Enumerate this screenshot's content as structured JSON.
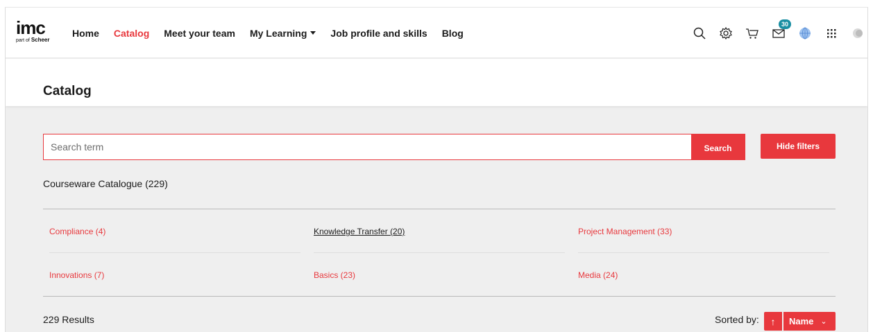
{
  "brand": {
    "logo_text": "imc",
    "logo_sub_small": "part of",
    "logo_sub_bold": "Scheer"
  },
  "nav": {
    "home": "Home",
    "catalog": "Catalog",
    "team": "Meet your team",
    "learning": "My Learning",
    "job": "Job profile and skills",
    "blog": "Blog"
  },
  "header_icons": {
    "search": "search-icon",
    "settings": "gear-icon",
    "cart": "cart-icon",
    "messages": "mail-icon",
    "messages_badge": "30",
    "language": "globe-icon",
    "apps": "apps-grid-icon",
    "profile": "avatar"
  },
  "page": {
    "title": "Catalog"
  },
  "search": {
    "placeholder": "Search term",
    "button_label": "Search",
    "hide_filters_label": "Hide filters"
  },
  "catalogue": {
    "name": "Courseware Catalogue (229)"
  },
  "categories": [
    {
      "label": "Compliance (4)"
    },
    {
      "label": "Knowledge Transfer (20)"
    },
    {
      "label": "Project Management (33)"
    },
    {
      "label": "Innovations (7)"
    },
    {
      "label": "Basics (23)"
    },
    {
      "label": "Media (24)"
    }
  ],
  "results": {
    "count_label": "229 Results",
    "sorted_by_label": "Sorted by:",
    "sort_direction": "↑",
    "sort_field": "Name"
  },
  "colors": {
    "accent": "#e8383d",
    "badge": "#1a8fa3",
    "background": "#efefef"
  }
}
